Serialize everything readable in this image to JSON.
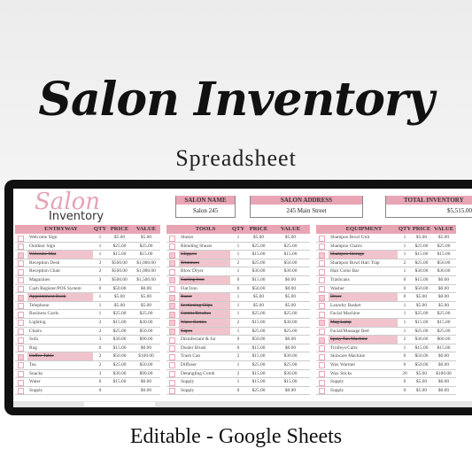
{
  "header": {
    "title": "Salon Inventory",
    "subtitle": "Spreadsheet"
  },
  "footer": {
    "text": "Editable - Google Sheets"
  },
  "colors": {
    "accent": "#e8a6b5",
    "checked_row": "#f0c4cd",
    "frame": "#111111"
  },
  "logo": {
    "script": "Salon",
    "word": "Inventory"
  },
  "info": {
    "salon_name": {
      "label": "SALON NAME",
      "value": "Salon 245"
    },
    "salon_address": {
      "label": "SALON ADDRESS",
      "value": "245 Main Street"
    },
    "total_inventory": {
      "label": "TOTAL INVENTORY",
      "value": "$5,515.00"
    }
  },
  "columns": {
    "qty": "QTY",
    "price": "PRICE",
    "value": "VALUE"
  },
  "tables": [
    {
      "title": "ENTRYWAY",
      "rows": [
        [
          "Welcome Sign",
          "1",
          "$5.00",
          "$5.00",
          false
        ],
        [
          "Outdoor Sign",
          "1",
          "$25.00",
          "$25.00",
          false
        ],
        [
          "Welcome Mat",
          "1",
          "$15.00",
          "$15.00",
          true
        ],
        [
          "Reception Desk",
          "2",
          "$500.00",
          "$1,000.00",
          false
        ],
        [
          "Reception Chair",
          "2",
          "$500.00",
          "$1,000.00",
          false
        ],
        [
          "Magazines",
          "3",
          "$500.00",
          "$1,500.00",
          false
        ],
        [
          "Cash Register/POS System",
          "0",
          "$50.00",
          "$0.00",
          false
        ],
        [
          "Appointment Book",
          "1",
          "$5.00",
          "$5.00",
          true
        ],
        [
          "Telephone",
          "1",
          "$5.00",
          "$5.00",
          false
        ],
        [
          "Business Cards",
          "1",
          "$25.00",
          "$25.00",
          false
        ],
        [
          "Lighting",
          "2",
          "$15.00",
          "$30.00",
          false
        ],
        [
          "Chairs",
          "2",
          "$25.00",
          "$50.00",
          false
        ],
        [
          "Sofa",
          "3",
          "$30.00",
          "$90.00",
          false
        ],
        [
          "Rug",
          "0",
          "$15.00",
          "$0.00",
          false
        ],
        [
          "Coffee Table",
          "2",
          "$50.00",
          "$100.00",
          true
        ],
        [
          "Tea",
          "2",
          "$25.00",
          "$50.00",
          false
        ],
        [
          "Snacks",
          "3",
          "$30.00",
          "$90.00",
          false
        ],
        [
          "Water",
          "0",
          "$15.00",
          "$0.00",
          false
        ],
        [
          "Supply",
          "0",
          "",
          "$0.00",
          false
        ]
      ]
    },
    {
      "title": "TOOLS",
      "rows": [
        [
          "Shears",
          "1",
          "$5.00",
          "$5.00",
          false
        ],
        [
          "Blending Shears",
          "1",
          "$25.00",
          "$25.00",
          false
        ],
        [
          "Clippers",
          "1",
          "$15.00",
          "$15.00",
          true
        ],
        [
          "Trimmers",
          "2",
          "$25.00",
          "$50.00",
          true
        ],
        [
          "Blow Dryer",
          "1",
          "$30.00",
          "$30.00",
          false
        ],
        [
          "Curling Iron",
          "0",
          "$15.00",
          "$0.00",
          true
        ],
        [
          "Flat Iron",
          "0",
          "$50.00",
          "$0.00",
          false
        ],
        [
          "Razor",
          "1",
          "$5.00",
          "$5.00",
          true
        ],
        [
          "Sectioning Clips",
          "1",
          "$5.00",
          "$5.00",
          true
        ],
        [
          "Combs/Brushes",
          "1",
          "$25.00",
          "$25.00",
          true
        ],
        [
          "Water Bottles",
          "2",
          "$15.00",
          "$30.00",
          true
        ],
        [
          "Capes",
          "1",
          "$25.00",
          "$25.00",
          true
        ],
        [
          "Disinfectant & Jar",
          "0",
          "$50.00",
          "$0.00",
          false
        ],
        [
          "Duster Brush",
          "0",
          "$15.00",
          "$0.00",
          false
        ],
        [
          "Trash Can",
          "2",
          "$15.00",
          "$30.00",
          false
        ],
        [
          "Diffuser",
          "1",
          "$25.00",
          "$25.00",
          false
        ],
        [
          "Detangling Comb",
          "2",
          "$15.00",
          "$30.00",
          false
        ],
        [
          "Supply",
          "1",
          "$15.00",
          "$15.00",
          false
        ],
        [
          "Supply",
          "0",
          "$25.00",
          "$0.00",
          false
        ]
      ]
    },
    {
      "title": "EQUIPMENT",
      "rows": [
        [
          "Shampoo Bowl Unit",
          "1",
          "$5.00",
          "$5.00",
          false
        ],
        [
          "Shampoo Chairs",
          "1",
          "$25.00",
          "$25.00",
          false
        ],
        [
          "Shampoo Storage",
          "1",
          "$15.00",
          "$15.00",
          true
        ],
        [
          "Shampoo Bowl Hair Trap",
          "2",
          "$25.00",
          "$50.00",
          false
        ],
        [
          "Hair Color Bar",
          "1",
          "$30.00",
          "$30.00",
          false
        ],
        [
          "Trashcans",
          "0",
          "$15.00",
          "$0.00",
          false
        ],
        [
          "Washer",
          "0",
          "$50.00",
          "$0.00",
          false
        ],
        [
          "Dryer",
          "0",
          "$5.00",
          "$0.00",
          true
        ],
        [
          "Laundry Basket",
          "1",
          "$5.00",
          "$5.00",
          false
        ],
        [
          "Facial Machine",
          "1",
          "$25.00",
          "$25.00",
          false
        ],
        [
          "Mag Lamp",
          "1",
          "$15.00",
          "$15.00",
          true
        ],
        [
          "Facial/Massage Bed",
          "1",
          "$25.00",
          "$25.00",
          false
        ],
        [
          "Spray Tan Machine",
          "2",
          "$30.00",
          "$60.00",
          true
        ],
        [
          "Trolleys/Carts",
          "1",
          "$15.00",
          "$15.00",
          false
        ],
        [
          "Skincare Machine",
          "0",
          "$50.00",
          "$0.00",
          false
        ],
        [
          "Wax Warmer",
          "0",
          "$50.00",
          "$0.00",
          false
        ],
        [
          "Wax Sticks",
          "20",
          "$5.00",
          "$100.00",
          false
        ],
        [
          "Supply",
          "0",
          "$5.00",
          "$0.00",
          false
        ],
        [
          "Supply",
          "0",
          "$5.00",
          "$0.00",
          false
        ]
      ]
    }
  ]
}
